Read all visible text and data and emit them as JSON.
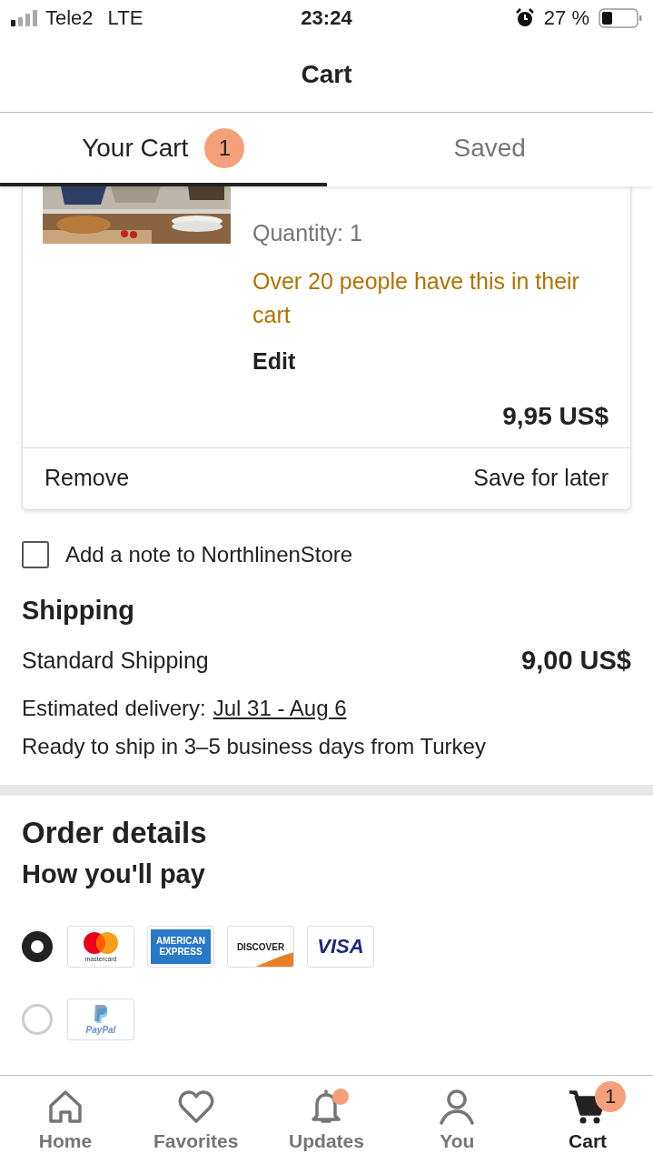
{
  "status_bar": {
    "carrier": "Tele2",
    "network": "LTE",
    "time": "23:24",
    "battery": "27 %"
  },
  "header": {
    "title": "Cart"
  },
  "tabs": [
    {
      "label": "Your Cart",
      "badge": "1",
      "selected": true
    },
    {
      "label": "Saved",
      "selected": false
    }
  ],
  "cart_item": {
    "quantity": "Quantity: 1",
    "notice": "Over 20 people have this in their cart",
    "edit": "Edit",
    "price": "9,95 US$",
    "actions": [
      "Remove",
      "Save for later"
    ]
  },
  "note": {
    "label": "Add a note to NorthlinenStore",
    "checked": false
  },
  "shipping": {
    "heading": "Shipping",
    "method": "Standard Shipping",
    "cost": "9,00 US$",
    "estimate_label": "Estimated delivery:",
    "estimate_dates": "Jul 31 - Aug 6",
    "ready": "Ready to ship in 3–5 business days from Turkey"
  },
  "order_details": {
    "heading": "Order details",
    "subheading": "How you'll pay",
    "payment_options": [
      {
        "selected": true,
        "cards": [
          {
            "kind": "mastercard",
            "lines": [
              "mastercard"
            ]
          },
          {
            "kind": "amex",
            "lines": [
              "AMERICAN",
              "EXPRESS"
            ]
          },
          {
            "kind": "discover",
            "lines": [
              "DISCOVER"
            ]
          },
          {
            "kind": "visa",
            "lines": [
              "VISA"
            ]
          }
        ]
      },
      {
        "selected": false,
        "cards": [
          {
            "kind": "paypal",
            "lines": [
              "PayPal"
            ]
          }
        ]
      }
    ]
  },
  "nav": [
    {
      "kind": "home",
      "label": "Home",
      "selected": false,
      "notification": false
    },
    {
      "kind": "favorites",
      "label": "Favorites",
      "selected": false,
      "notification": false
    },
    {
      "kind": "updates",
      "label": "Updates",
      "selected": false,
      "notification": true
    },
    {
      "kind": "you",
      "label": "You",
      "selected": false,
      "notification": false
    },
    {
      "kind": "cart",
      "label": "Cart",
      "selected": true,
      "notification": false,
      "badge": "1"
    }
  ]
}
